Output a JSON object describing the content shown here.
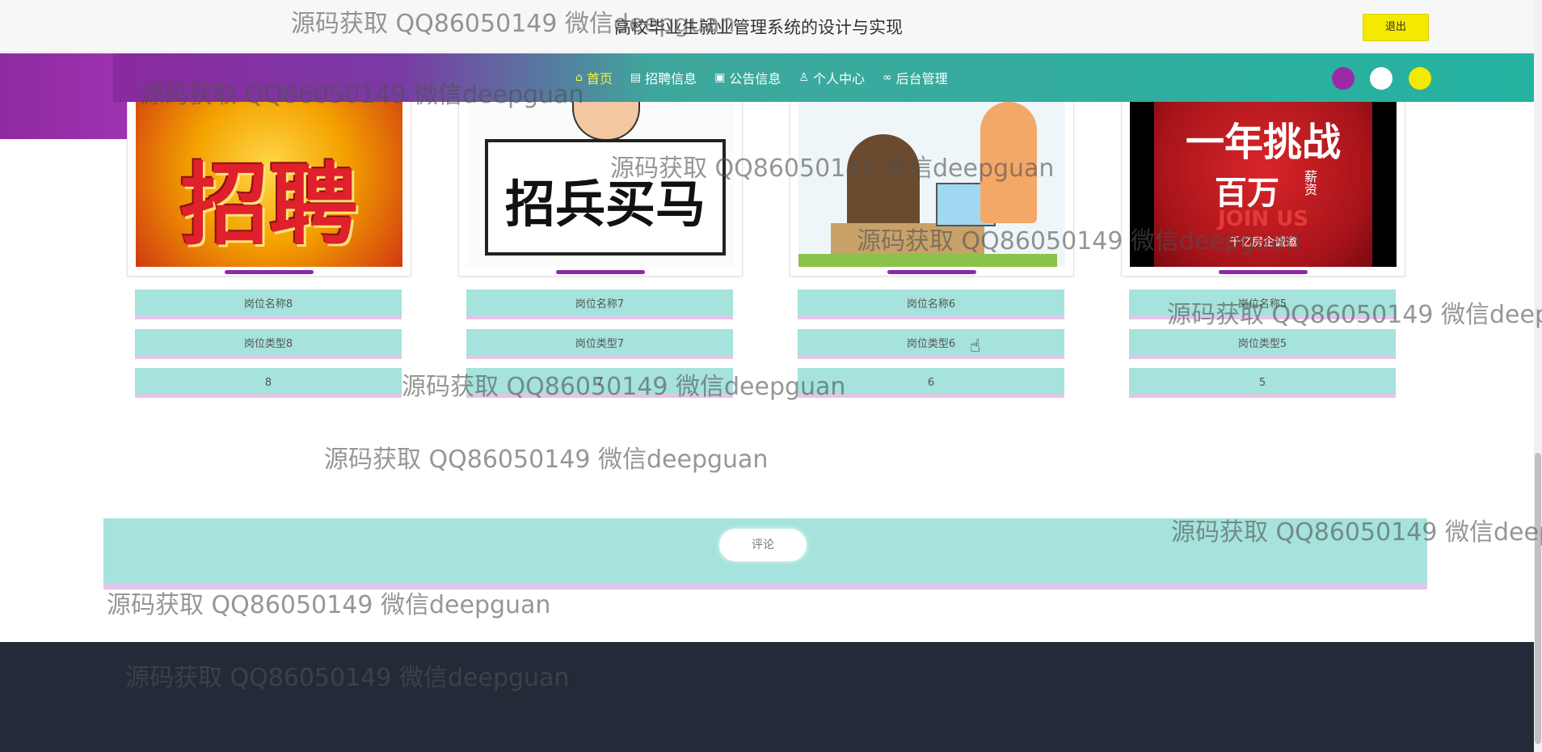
{
  "header": {
    "site_title": "高校毕业生就业管理系统的设计与实现",
    "logout_label": "退出"
  },
  "nav": {
    "items": [
      {
        "label": "首页",
        "icon": "home-icon"
      },
      {
        "label": "招聘信息",
        "icon": "newspaper-icon"
      },
      {
        "label": "公告信息",
        "icon": "gift-icon"
      },
      {
        "label": "个人中心",
        "icon": "user-icon"
      },
      {
        "label": "后台管理",
        "icon": "link-icon"
      }
    ],
    "active_index": 0
  },
  "theme_colors": [
    "#9b2aa6",
    "#ffffff",
    "#f4e900"
  ],
  "jobs": [
    {
      "name": "岗位名称8",
      "type": "岗位类型8",
      "num": "8",
      "image": "recruitment-banner-zhaopin"
    },
    {
      "name": "岗位名称7",
      "type": "岗位类型7",
      "num": "7",
      "image": "recruitment-banner-zhaobingmaima"
    },
    {
      "name": "岗位名称6",
      "type": "岗位类型6",
      "num": "6",
      "image": "recruitment-interview-illustration"
    },
    {
      "name": "岗位名称5",
      "type": "岗位类型5",
      "num": "5",
      "image": "recruitment-banner-yinian-tiaozhan"
    }
  ],
  "image_texts": {
    "zhaopin": "招聘",
    "zhaobingmaima": "招兵买马",
    "yinian_tiaozhan_line1": "一年挑战",
    "yinian_tiaozhan_line2": "百万",
    "yinian_tiaozhan_line2b": "薪资",
    "yinian_tiaozhan_line3": "JOIN US",
    "yinian_tiaozhan_line4": "千亿房企诚邀"
  },
  "comment": {
    "button_label": "评论"
  },
  "watermark": "源码获取 QQ86050149 微信deepguan",
  "colors": {
    "pill_bg": "#a5e3dc",
    "pill_border": "#e1c5ea",
    "nav_teal": "#24b3a0",
    "nav_purple": "#8a2a9e",
    "footer_bg": "#232b38",
    "active_nav": "#f7f040"
  }
}
